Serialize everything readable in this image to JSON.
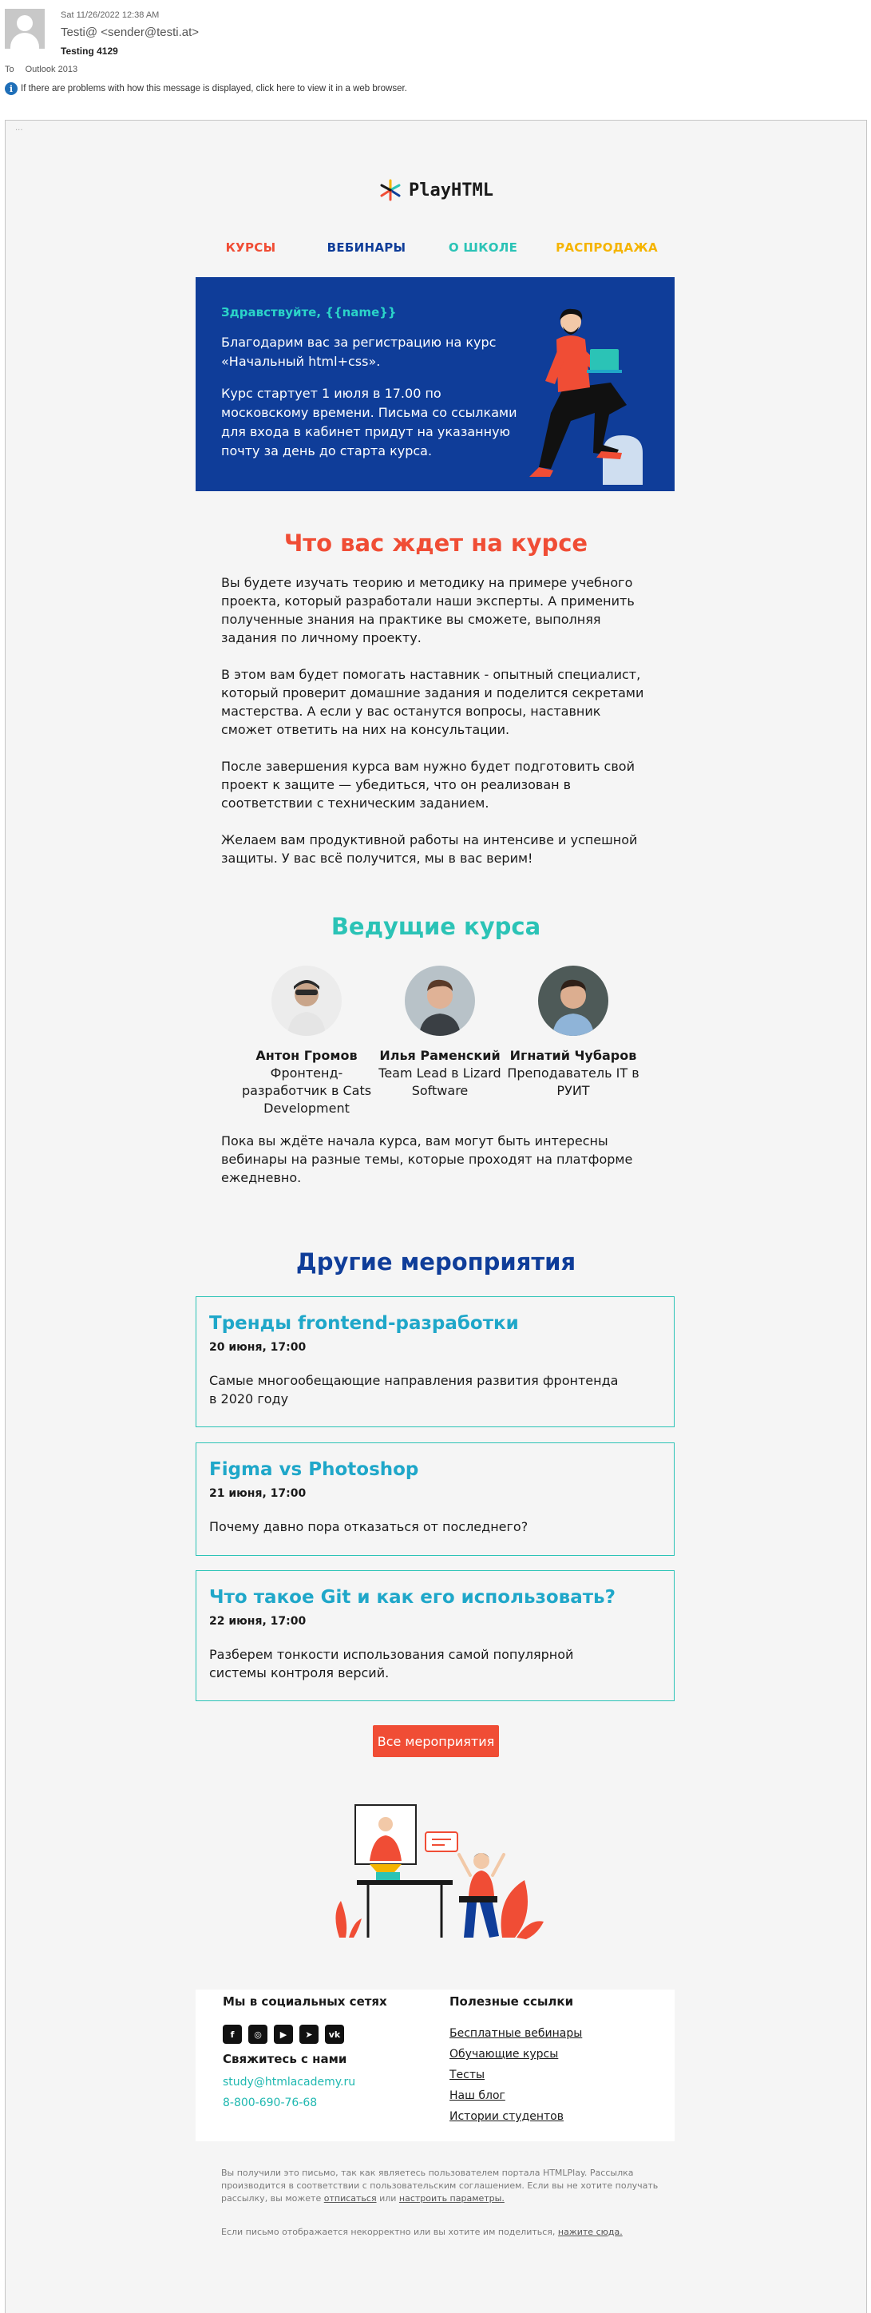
{
  "outlook": {
    "date": "Sat 11/26/2022 12:38 AM",
    "from": "Testi@ <sender@testi.at>",
    "subject": "Testing 4129",
    "to_label": "To",
    "to_value": "Outlook 2013",
    "info": "If there are problems with how this message is displayed, click here to view it in a web browser.",
    "frame_mark": "..."
  },
  "logo": {
    "text": "PlayHTML"
  },
  "nav": [
    {
      "label": "КУРСЫ",
      "color": "#f04d35"
    },
    {
      "label": "ВЕБИНАРЫ",
      "color": "#0f3d99"
    },
    {
      "label": "О ШКОЛЕ",
      "color": "#2bc3b6"
    },
    {
      "label": "РАСПРОДАЖА",
      "color": "#f5b400"
    }
  ],
  "hero": {
    "greeting": "Здравствуйте, {{name}}",
    "p1": "Благодарим вас за регистрацию на курс «Начальный html+css».",
    "p2": "Курс стартует 1 июля в 17.00 по московскому времени. Письма со ссылками для входа в кабинет придут на указанную почту за день до старта курса."
  },
  "course": {
    "title": "Что вас ждет на курсе",
    "paragraphs": [
      "Вы будете изучать теорию и методику на примере учебного проекта, который разработали наши эксперты. А применить полученные знания на практике вы сможете, выполняя задания по личному проекту.",
      "В этом вам будет помогать наставник - опытный специалист, который проверит домашние задания и поделится секретами мастерства. А если у вас останутся вопросы, наставник сможет ответить на них на консультации.",
      "После завершения курса вам нужно будет подготовить свой проект к защите — убедиться, что он реализован в соответствии с техническим заданием.",
      "Желаем вам продуктивной работы на интенсиве и успешной защиты. У вас всё получится, мы в вас верим!"
    ]
  },
  "teachers": {
    "title": "Ведущие курса",
    "items": [
      {
        "name": "Антон Громов",
        "role": "Фронтенд-разработчик в Cats Development"
      },
      {
        "name": "Илья Раменский",
        "role": "Team Lead в Lizard Software"
      },
      {
        "name": "Игнатий Чубаров",
        "role": "Преподаватель IT в РУИТ"
      }
    ],
    "note": "Пока вы ждёте начала курса, вам могут быть интересны вебинары на разные темы, которые проходят на платформе ежедневно."
  },
  "events": {
    "title": "Другие мероприятия",
    "items": [
      {
        "title": "Тренды frontend-разработки",
        "date": "20 июня, 17:00",
        "desc": "Самые многообещающие направления развития фронтенда в 2020 году"
      },
      {
        "title": "Figma vs Photoshop",
        "date": "21 июня, 17:00",
        "desc": "Почему давно пора отказаться от последнего?"
      },
      {
        "title": "Что такое Git и как его использовать?",
        "date": "22 июня, 17:00",
        "desc": "Разберем тонкости использования самой популярной системы контроля версий."
      }
    ],
    "button": "Все мероприятия"
  },
  "footer": {
    "social_title": "Мы в социальных сетях",
    "socials": [
      {
        "icon": "facebook-icon",
        "glyph": "f"
      },
      {
        "icon": "instagram-icon",
        "glyph": "◎"
      },
      {
        "icon": "youtube-icon",
        "glyph": "▶"
      },
      {
        "icon": "telegram-icon",
        "glyph": "➤"
      },
      {
        "icon": "vk-icon",
        "glyph": "vk"
      }
    ],
    "contact_title": "Свяжитесь с нами",
    "email": "study@htmlacademy.ru",
    "phone": "8-800-690-76-68",
    "links_title": "Полезные ссылки",
    "links": [
      "Бесплатные вебинары",
      "Обучающие курсы",
      "Тесты",
      "Наш блог",
      "Истории студентов"
    ]
  },
  "legal": {
    "p1_before": "Вы получили это письмо, так как являетесь пользователем портала HTMLPlay. Рассылка производится в соответствии с пользовательским соглашением. Если вы не хотите получать рассылку, вы можете",
    "unsubscribe": "отписаться",
    "p1_mid": "или",
    "settings": "настроить параметры.",
    "p2_before": "Если письмо отображается некорректно или вы хотите им поделиться,",
    "click_here": "нажите сюда."
  },
  "colors": {
    "red": "#f04d35",
    "blue": "#0f3d99",
    "teal": "#2bc3b6",
    "yellow": "#f5b400"
  }
}
